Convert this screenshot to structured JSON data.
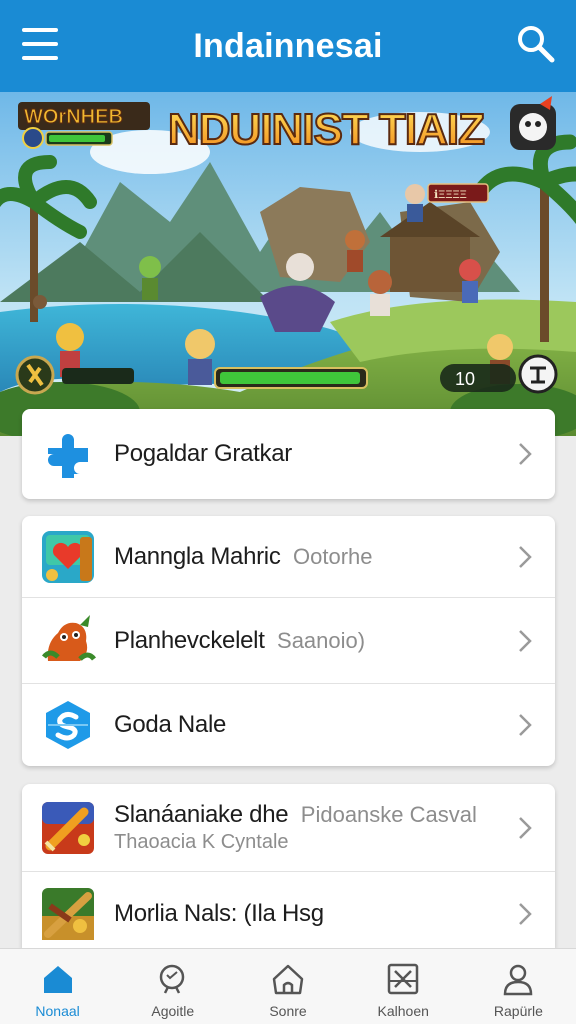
{
  "header": {
    "title": "Indainnesai",
    "menu_icon": "hamburger-menu-icon",
    "search_icon": "search-icon"
  },
  "banner": {
    "title_left": "WOrNHEB",
    "title_main": "NDUINIST TIAIZ",
    "sign": "ℹ︎ΞΞΞΞ",
    "counter": "10"
  },
  "lists": {
    "card1": [
      {
        "primary": "Pogaldar Gratkar",
        "secondary": "",
        "icon": "puzzle-icon"
      }
    ],
    "card2": [
      {
        "primary": "Manngla Mahric",
        "secondary": "Ootorhe",
        "icon": "heart-game-icon"
      },
      {
        "primary": "Planhevckelelt",
        "secondary": "Saanoio)",
        "icon": "dragon-icon"
      },
      {
        "primary": "Goda Nale",
        "secondary": "",
        "icon": "blue-badge-icon"
      }
    ],
    "card3": [
      {
        "primary": "Slanáaniake dhe",
        "secondary": "Pidoanske Casval",
        "sub": "Thaoacia K Cyntale",
        "icon": "sword-game-icon"
      },
      {
        "primary": "Morlia Nals: (Ila Hsg",
        "secondary": "",
        "icon": "warrior-game-icon"
      }
    ]
  },
  "bottom_nav": [
    {
      "label": "Nonaal",
      "icon": "home-icon",
      "active": true
    },
    {
      "label": "Agoitle",
      "icon": "search-person-icon",
      "active": false
    },
    {
      "label": "Sonre",
      "icon": "house-outline-icon",
      "active": false
    },
    {
      "label": "Kalhoen",
      "icon": "box-icon",
      "active": false
    },
    {
      "label": "Rapürle",
      "icon": "profile-icon",
      "active": false
    }
  ],
  "colors": {
    "accent": "#1a8bd4",
    "background": "#ececec",
    "health_bar": "#3fc63a"
  }
}
